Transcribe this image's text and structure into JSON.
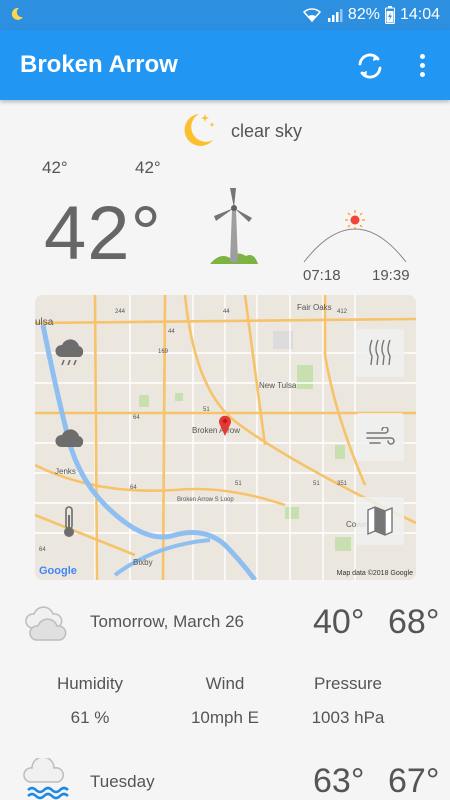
{
  "status_bar": {
    "battery": "82%",
    "time": "14:04"
  },
  "app_bar": {
    "title": "Broken Arrow"
  },
  "current": {
    "condition": "clear sky",
    "low": "42°",
    "high": "42°",
    "temp": "42°",
    "sunrise": "07:18",
    "sunset": "19:39"
  },
  "map": {
    "attribution": "Map data ©2018 Google",
    "logo": "Google",
    "labels": {
      "tulsa": "ulsa",
      "fair_oaks": "Fair Oaks",
      "new_tulsa": "New Tulsa",
      "broken_arrow": "Broken Arrow",
      "jenks": "Jenks",
      "bixby": "Bixby",
      "coweta": "Coweta",
      "loop": "Broken Arrow S Loop",
      "route_244": "244",
      "route_44a": "44",
      "route_44b": "44",
      "route_412": "412",
      "route_169": "169",
      "route_51": "51",
      "route_64": "64",
      "route_51b": "51",
      "route_51c": "51",
      "route_351": "351",
      "route_64b": "64",
      "route_64c": "64"
    }
  },
  "forecast": [
    {
      "date": "Tomorrow, March 26",
      "low": "40°",
      "high": "68°"
    },
    {
      "date": "Tuesday",
      "low": "63°",
      "high": "67°"
    }
  ],
  "details": {
    "humidity_label": "Humidity",
    "humidity_value": "61 %",
    "wind_label": "Wind",
    "wind_value": "10mph E",
    "pressure_label": "Pressure",
    "pressure_value": "1003 hPa"
  }
}
